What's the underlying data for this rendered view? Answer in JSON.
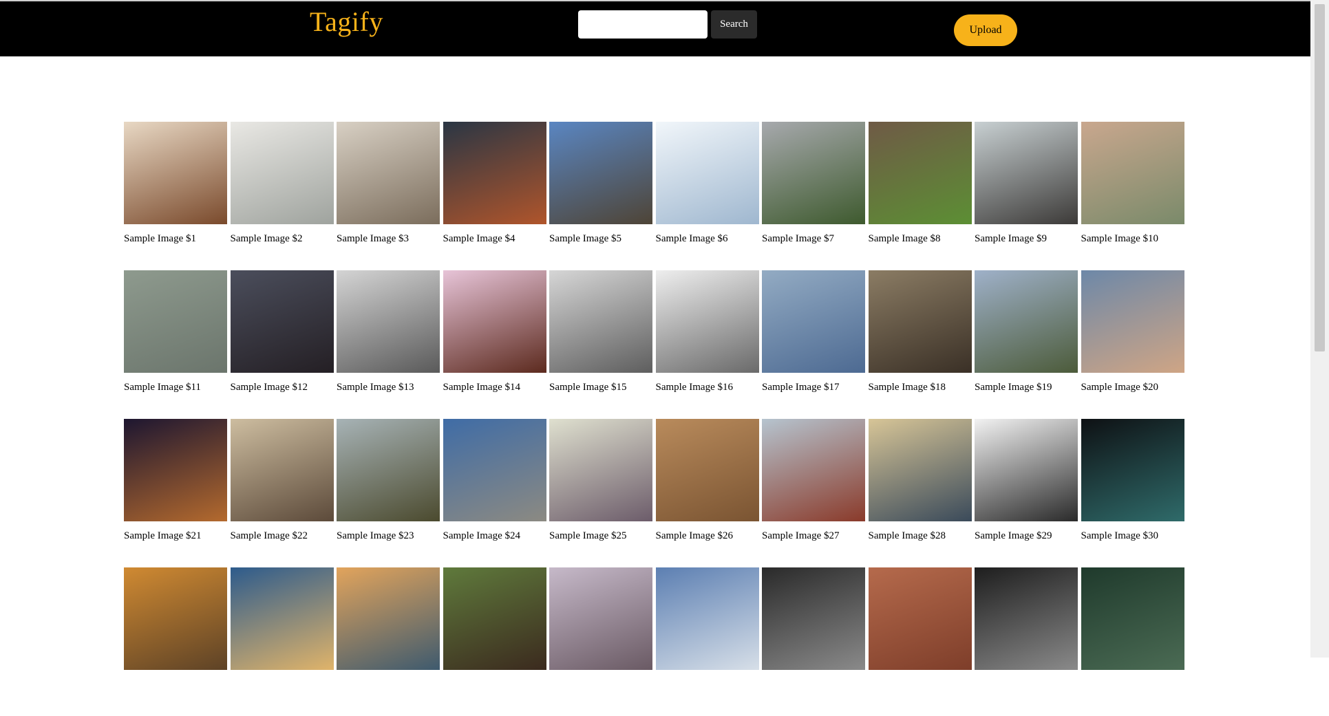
{
  "app": {
    "title": "Tagify"
  },
  "header": {
    "search_placeholder": "",
    "search_label": "Search",
    "upload_label": "Upload",
    "accent_color": "#f7b21a"
  },
  "gallery": {
    "rows": [
      [
        {
          "caption": "Sample Image $1",
          "colors": [
            "#e8d8c4",
            "#7a4a2c"
          ]
        },
        {
          "caption": "Sample Image $2",
          "colors": [
            "#e9e8e4",
            "#9fa39e"
          ]
        },
        {
          "caption": "Sample Image $3",
          "colors": [
            "#d8d0c4",
            "#7b6d5c"
          ]
        },
        {
          "caption": "Sample Image $4",
          "colors": [
            "#2a3644",
            "#b0552b"
          ]
        },
        {
          "caption": "Sample Image $5",
          "colors": [
            "#5a86c2",
            "#4e4436"
          ]
        },
        {
          "caption": "Sample Image $6",
          "colors": [
            "#f1f6fa",
            "#9fb7cf"
          ]
        },
        {
          "caption": "Sample Image $7",
          "colors": [
            "#a7a9ad",
            "#3e5a2e"
          ]
        },
        {
          "caption": "Sample Image $8",
          "colors": [
            "#6f5a46",
            "#5c8f34"
          ]
        },
        {
          "caption": "Sample Image $9",
          "colors": [
            "#c8d0d2",
            "#3c3a38"
          ]
        },
        {
          "caption": "Sample Image $10",
          "colors": [
            "#c9a78e",
            "#7a8a6a"
          ]
        }
      ],
      [
        {
          "caption": "Sample Image $11",
          "colors": [
            "#8e9a8e",
            "#6b756c"
          ]
        },
        {
          "caption": "Sample Image $12",
          "colors": [
            "#4b4e5c",
            "#241f24"
          ]
        },
        {
          "caption": "Sample Image $13",
          "colors": [
            "#d4d4d4",
            "#5a5a5a"
          ]
        },
        {
          "caption": "Sample Image $14",
          "colors": [
            "#e7c4d8",
            "#5c2a1e"
          ]
        },
        {
          "caption": "Sample Image $15",
          "colors": [
            "#d6d6d6",
            "#5e5e5e"
          ]
        },
        {
          "caption": "Sample Image $16",
          "colors": [
            "#eeeeee",
            "#6a6a6a"
          ]
        },
        {
          "caption": "Sample Image $17",
          "colors": [
            "#93abc3",
            "#4d6a92"
          ]
        },
        {
          "caption": "Sample Image $18",
          "colors": [
            "#8b7c64",
            "#3a3026"
          ]
        },
        {
          "caption": "Sample Image $19",
          "colors": [
            "#9fb1c9",
            "#4c5b3a"
          ]
        },
        {
          "caption": "Sample Image $20",
          "colors": [
            "#6d88a8",
            "#cfa585"
          ]
        }
      ],
      [
        {
          "caption": "Sample Image $21",
          "colors": [
            "#1d1630",
            "#b46a2e"
          ]
        },
        {
          "caption": "Sample Image $22",
          "colors": [
            "#cdbda0",
            "#5c4a3a"
          ]
        },
        {
          "caption": "Sample Image $23",
          "colors": [
            "#a7b3b6",
            "#4b4a2e"
          ]
        },
        {
          "caption": "Sample Image $24",
          "colors": [
            "#3f6ca6",
            "#8c8a82"
          ]
        },
        {
          "caption": "Sample Image $25",
          "colors": [
            "#dfe0cf",
            "#6c5c6a"
          ]
        },
        {
          "caption": "Sample Image $26",
          "colors": [
            "#b98b5c",
            "#7a5432"
          ]
        },
        {
          "caption": "Sample Image $27",
          "colors": [
            "#b6c4cf",
            "#8a3a2a"
          ]
        },
        {
          "caption": "Sample Image $28",
          "colors": [
            "#d7c597",
            "#3a4a5a"
          ]
        },
        {
          "caption": "Sample Image $29",
          "colors": [
            "#f2f2f2",
            "#2a2a2a"
          ]
        },
        {
          "caption": "Sample Image $30",
          "colors": [
            "#0e1114",
            "#2f6b6a"
          ]
        }
      ],
      [
        {
          "caption": "",
          "colors": [
            "#d08a32",
            "#5d4226"
          ]
        },
        {
          "caption": "",
          "colors": [
            "#2d5b8c",
            "#e0b46a"
          ]
        },
        {
          "caption": "",
          "colors": [
            "#e2a45c",
            "#3e5a6e"
          ]
        },
        {
          "caption": "",
          "colors": [
            "#5f7a3c",
            "#3b2a1e"
          ]
        },
        {
          "caption": "",
          "colors": [
            "#c6b9c9",
            "#6a5a64"
          ]
        },
        {
          "caption": "",
          "colors": [
            "#5c7fb2",
            "#d7dfe8"
          ]
        },
        {
          "caption": "",
          "colors": [
            "#2a2a2a",
            "#8a8a8a"
          ]
        },
        {
          "caption": "",
          "colors": [
            "#b56a4c",
            "#7e3e2a"
          ]
        },
        {
          "caption": "",
          "colors": [
            "#1e1e1e",
            "#8a8a8a"
          ]
        },
        {
          "caption": "",
          "colors": [
            "#1f3a2c",
            "#4b6b54"
          ]
        }
      ]
    ]
  }
}
